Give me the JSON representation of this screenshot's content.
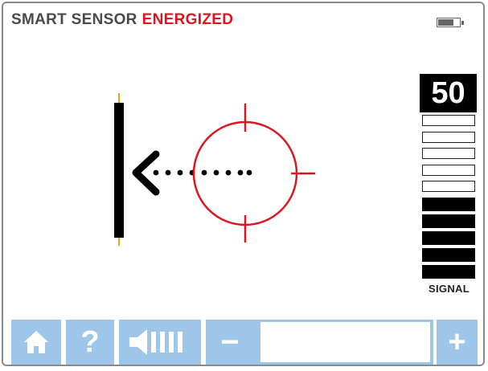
{
  "header": {
    "title": "SMART SENSOR",
    "status": "ENERGIZED",
    "title_color": "#4a4a4a",
    "status_color": "#e0141e"
  },
  "battery": {
    "icon": "battery-icon",
    "level": 0.75
  },
  "sensor_graphic": {
    "wall_icon": "wall-line-icon",
    "arrow_icon": "left-arrow-chevron-icon",
    "trail_icon": "dotted-trail-icon",
    "target_icon": "crosshair-target-icon",
    "target_color": "#e0141e"
  },
  "signal": {
    "value": "50",
    "label": "SIGNAL",
    "total_bars": 10,
    "active_bars": 5
  },
  "toolbar": {
    "home_icon": "home-icon",
    "help_label": "?",
    "volume_icon": "speaker-volume-icon",
    "minus_label": "−",
    "plus_label": "+",
    "button_color": "#9ec5ea"
  }
}
